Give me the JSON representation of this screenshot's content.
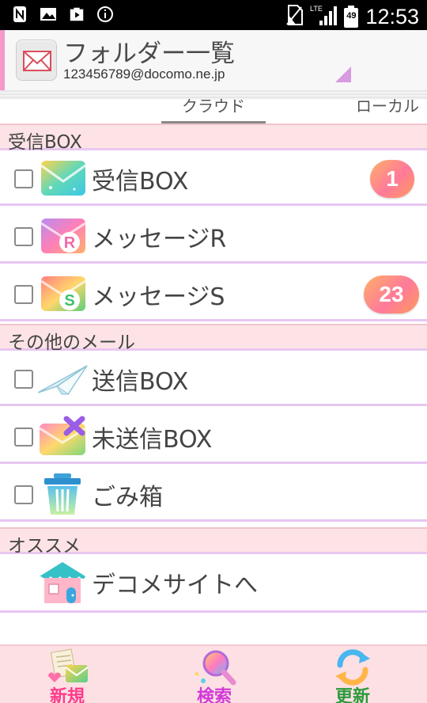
{
  "status_bar": {
    "time": "12:53",
    "battery_level": "49",
    "network_type": "LTE",
    "icons": [
      "nfc-icon",
      "image-icon",
      "play-store-icon",
      "info-icon",
      "no-sim-icon",
      "signal-icon",
      "battery-icon"
    ]
  },
  "header": {
    "title": "フォルダー一覧",
    "address": "123456789@docomo.ne.jp",
    "icon": "mail-envelope-icon"
  },
  "tabs": [
    {
      "label": "クラウド",
      "selected": true
    },
    {
      "label": "ローカル",
      "selected": false
    }
  ],
  "sections": [
    {
      "title": "受信BOX",
      "items": [
        {
          "label": "受信BOX",
          "icon": "inbox-envelope-icon",
          "badge": "1"
        },
        {
          "label": "メッセージR",
          "icon": "message-r-icon",
          "badge": ""
        },
        {
          "label": "メッセージS",
          "icon": "message-s-icon",
          "badge": "23"
        }
      ]
    },
    {
      "title": "その他のメール",
      "items": [
        {
          "label": "送信BOX",
          "icon": "paper-plane-icon",
          "badge": ""
        },
        {
          "label": "未送信BOX",
          "icon": "unsent-envelope-icon",
          "badge": ""
        },
        {
          "label": "ごみ箱",
          "icon": "trash-icon",
          "badge": ""
        }
      ]
    },
    {
      "title": "オススメ",
      "items": [
        {
          "label": "デコメサイトへ",
          "icon": "house-icon",
          "badge": ""
        }
      ]
    }
  ],
  "toolbar": {
    "new_label": "新規",
    "search_label": "検索",
    "refresh_label": "更新",
    "colors": {
      "new": "#ff3b8a",
      "search": "#d23ad6",
      "refresh": "#2c9a3c"
    }
  },
  "colors": {
    "section_bg": "#fde3e6",
    "divider": "#e6c6f2",
    "toolbar_bg": "#fde0e4"
  }
}
